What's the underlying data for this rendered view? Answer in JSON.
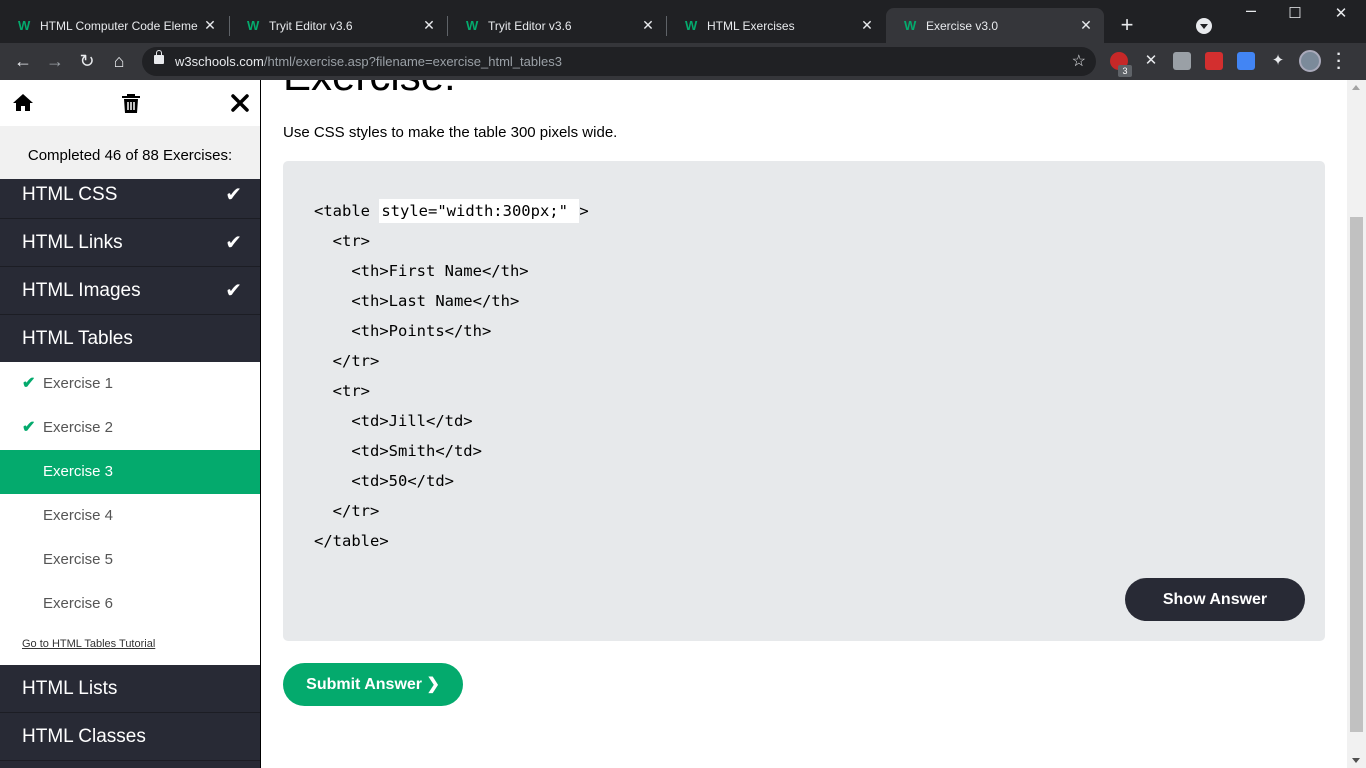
{
  "browser": {
    "tabs": [
      {
        "title": "HTML Computer Code Eleme",
        "active": false
      },
      {
        "title": "Tryit Editor v3.6",
        "active": false
      },
      {
        "title": "Tryit Editor v3.6",
        "active": false
      },
      {
        "title": "HTML Exercises",
        "active": false
      },
      {
        "title": "Exercise v3.0",
        "active": true
      }
    ],
    "url_host": "w3schools.com",
    "url_path": "/html/exercise.asp?filename=exercise_html_tables3",
    "extension_badge": "3",
    "favicon_letter": "W",
    "colors": {
      "frame": "#202124",
      "toolbar": "#35363a"
    }
  },
  "sidebar": {
    "completed_text": "Completed 46 of 88 Exercises:",
    "categories_top": [
      {
        "label": "HTML CSS",
        "done": true
      },
      {
        "label": "HTML Links",
        "done": true
      },
      {
        "label": "HTML Images",
        "done": true
      },
      {
        "label": "HTML Tables",
        "done": false
      }
    ],
    "exercises": [
      {
        "label": "Exercise 1",
        "done": true,
        "active": false
      },
      {
        "label": "Exercise 2",
        "done": true,
        "active": false
      },
      {
        "label": "Exercise 3",
        "done": false,
        "active": true
      },
      {
        "label": "Exercise 4",
        "done": false,
        "active": false
      },
      {
        "label": "Exercise 5",
        "done": false,
        "active": false
      },
      {
        "label": "Exercise 6",
        "done": false,
        "active": false
      }
    ],
    "tutorial_link": "Go to HTML Tables Tutorial",
    "categories_bottom": [
      {
        "label": "HTML Lists"
      },
      {
        "label": "HTML Classes"
      }
    ],
    "check_glyph": "✔",
    "colors": {
      "dark": "#282a35",
      "accent": "#04aa6d"
    }
  },
  "main": {
    "heading": "Exercise:",
    "instruction": "Use CSS styles to make the table 300 pixels wide.",
    "code": {
      "line0_before": "<table ",
      "input_value": "style=\"width:300px;\"",
      "line0_after": ">",
      "lines": [
        "  <tr>",
        "    <th>First Name</th>",
        "    <th>Last Name</th>",
        "    <th>Points</th>",
        "  </tr>",
        "  <tr>",
        "    <td>Jill</td>",
        "    <td>Smith</td>",
        "    <td>50</td>",
        "  </tr>",
        "</table>"
      ]
    },
    "show_answer_label": "Show Answer",
    "submit_label": "Submit Answer ❯"
  }
}
